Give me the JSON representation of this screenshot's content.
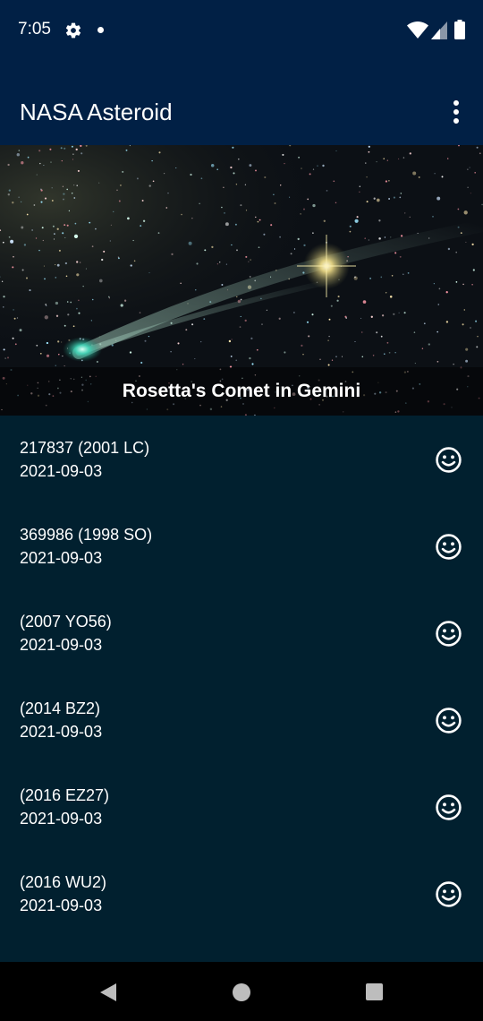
{
  "status_bar": {
    "time": "7:05",
    "icons": [
      "gear-icon",
      "notification-dot-icon",
      "wifi-icon",
      "signal-icon",
      "battery-icon"
    ]
  },
  "app_bar": {
    "title": "NASA Asteroid",
    "menu_icon": "more-vert-icon"
  },
  "picture_of_day": {
    "caption": "Rosetta's Comet in Gemini"
  },
  "asteroids": [
    {
      "name": "217837 (2001 LC)",
      "date": "2021-09-03",
      "status_icon": "smiley-icon"
    },
    {
      "name": "369986 (1998 SO)",
      "date": "2021-09-03",
      "status_icon": "smiley-icon"
    },
    {
      "name": "(2007 YO56)",
      "date": "2021-09-03",
      "status_icon": "smiley-icon"
    },
    {
      "name": "(2014 BZ2)",
      "date": "2021-09-03",
      "status_icon": "smiley-icon"
    },
    {
      "name": "(2016 EZ27)",
      "date": "2021-09-03",
      "status_icon": "smiley-icon"
    },
    {
      "name": "(2016 WU2)",
      "date": "2021-09-03",
      "status_icon": "smiley-icon"
    }
  ],
  "nav_bar": {
    "icons": [
      "back-icon",
      "home-icon",
      "recents-icon"
    ]
  },
  "colors": {
    "app_bar": "#012045",
    "background": "#01202f",
    "text": "#ffffff"
  }
}
